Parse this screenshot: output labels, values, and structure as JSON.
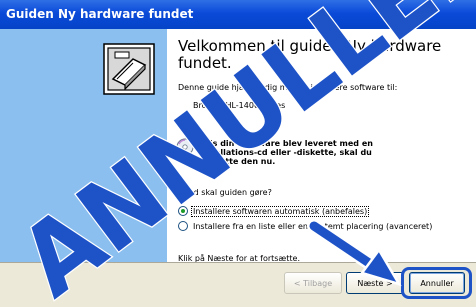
{
  "window": {
    "title": "Guiden Ny hardware fundet"
  },
  "main": {
    "heading": "Velkommen til guiden Ny hardware fundet.",
    "description": "Denne guide hjælper dig med at installere software til:",
    "device": "Brother   HL-1400 series",
    "cd_hint": "Hvis din hardware blev leveret med en installations-cd eller -diskette, skal du indsætte den nu.",
    "question": "Hvad skal guiden gøre?",
    "options": [
      {
        "label": "Installere softwaren automatisk (anbefales)",
        "selected": true
      },
      {
        "label": "Installere fra en liste eller en bestemt placering (avanceret)",
        "selected": false
      }
    ],
    "footer_note": "Klik på Næste for at fortsætte."
  },
  "buttons": {
    "back": "< Tilbage",
    "next": "Næste >",
    "cancel": "Annuller"
  },
  "overlay": {
    "word": "ANNULLER",
    "color": "#1e53c8"
  },
  "colors": {
    "titlebar": "#0a4ad8",
    "side_panel": "#8bbfef",
    "footer": "#ece9d8"
  },
  "icons": {
    "hardware": "hardware-wizard-icon",
    "cd": "cd-icon",
    "arrow": "arrow-icon"
  }
}
